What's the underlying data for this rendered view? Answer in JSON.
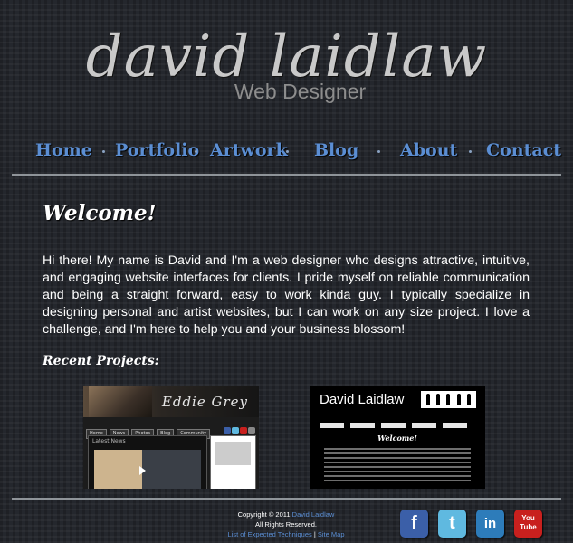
{
  "logo": {
    "name": "david laidlaw",
    "subtitle": "Web Designer"
  },
  "nav": {
    "items": [
      {
        "label": "Home"
      },
      {
        "label": "Portfolio"
      },
      {
        "label": "Artwork"
      },
      {
        "label": "Blog"
      },
      {
        "label": "About"
      },
      {
        "label": "Contact"
      }
    ]
  },
  "main": {
    "heading": "Welcome!",
    "intro": "Hi there!   My name is David and I'm a web designer who designs attractive, intuitive, and engaging website interfaces for clients.    I pride myself on reliable communication and being a straight forward, easy to work kinda guy.    I typically specialize in designing personal and artist websites, but I can work on any size project.    I love a challenge, and I'm here to help you and your business blossom!",
    "recent_heading": "Recent Projects:"
  },
  "projects": [
    {
      "name": "Eddie Grey",
      "menu": [
        "Home",
        "News",
        "Photos",
        "Blog",
        "Community"
      ],
      "section_title": "Latest News"
    },
    {
      "name": "David Laidlaw",
      "heading": "Welcome!"
    }
  ],
  "footer": {
    "copyright_prefix": "Copyright © 2011",
    "owner_link": "David Laidlaw",
    "rights": "All Rights Reserved.",
    "link1": "List of Expected Techniques",
    "separator": "|",
    "link2": "Site Map"
  },
  "social": [
    {
      "icon": "facebook-icon",
      "glyph": "f",
      "color": "#3b5fa8"
    },
    {
      "icon": "twitter-icon",
      "glyph": "t",
      "color": "#5fb9e0"
    },
    {
      "icon": "linkedin-icon",
      "glyph": "in",
      "color": "#2d7cba"
    },
    {
      "icon": "youtube-icon",
      "glyph": "You Tube",
      "color": "#c8201e"
    }
  ],
  "colors": {
    "link": "#5b8ed3",
    "background": "#24272d",
    "rule": "#8f9499"
  }
}
